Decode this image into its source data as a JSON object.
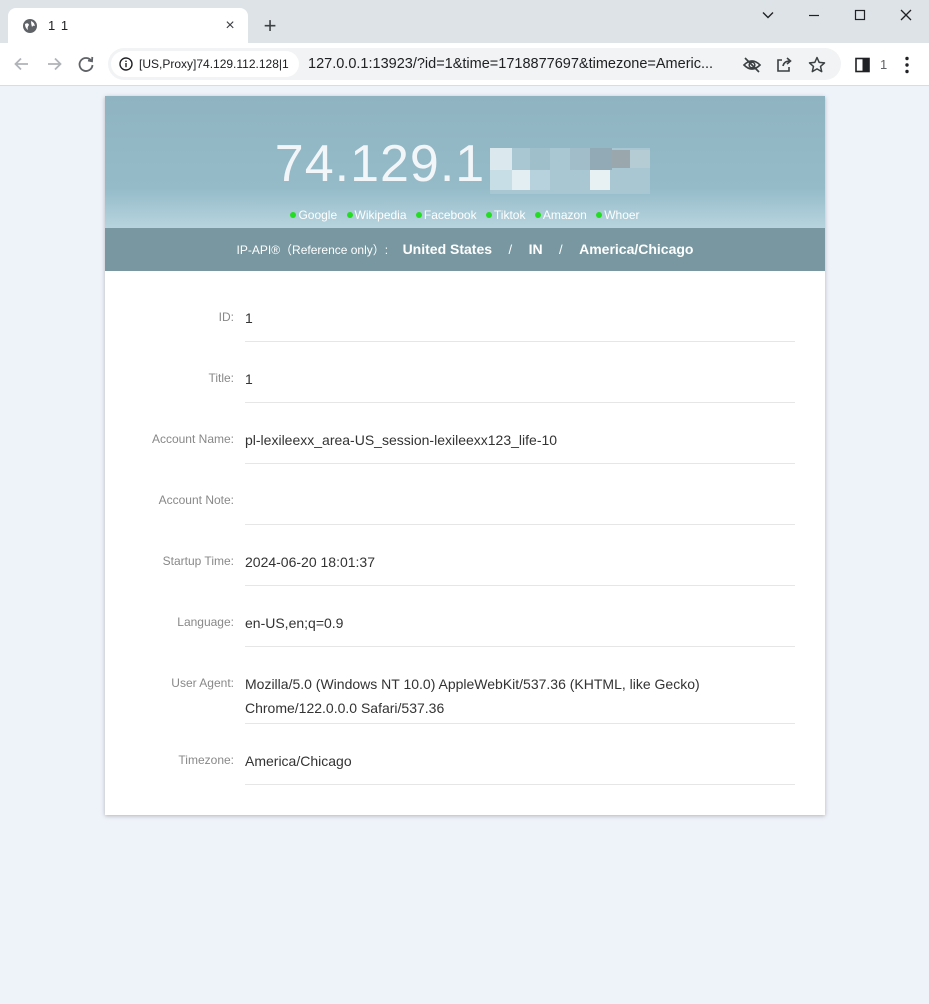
{
  "browser": {
    "tab_title": "1 1",
    "tab_close": "×",
    "new_tab": "+",
    "omnibox_chip": "[US,Proxy]74.129.112.128|1",
    "url": "127.0.0.1:13923/?id=1&time=1718877697&timezone=Americ...",
    "profile_count": "1"
  },
  "hero": {
    "ip": "74.129.1",
    "links": [
      "Google",
      "Wikipedia",
      "Facebook",
      "Tiktok",
      "Amazon",
      "Whoer"
    ]
  },
  "geo": {
    "label": "IP-API®（Reference only）:",
    "country": "United States",
    "sep1": "/",
    "region": "IN",
    "sep2": "/",
    "timezone": "America/Chicago"
  },
  "rows": [
    {
      "label": "ID:",
      "value": "1"
    },
    {
      "label": "Title:",
      "value": "1"
    },
    {
      "label": "Account Name:",
      "value": "pl-lexileexx_area-US_session-lexileexx123_life-10"
    },
    {
      "label": "Account Note:",
      "value": ""
    },
    {
      "label": "Startup Time:",
      "value": "2024-06-20 18:01:37"
    },
    {
      "label": "Language:",
      "value": "en-US,en;q=0.9"
    },
    {
      "label": "User Agent:",
      "value": "Mozilla/5.0 (Windows NT 10.0) AppleWebKit/537.36 (KHTML, like Gecko) Chrome/122.0.0.0 Safari/537.36"
    },
    {
      "label": "Timezone:",
      "value": "America/Chicago"
    }
  ]
}
